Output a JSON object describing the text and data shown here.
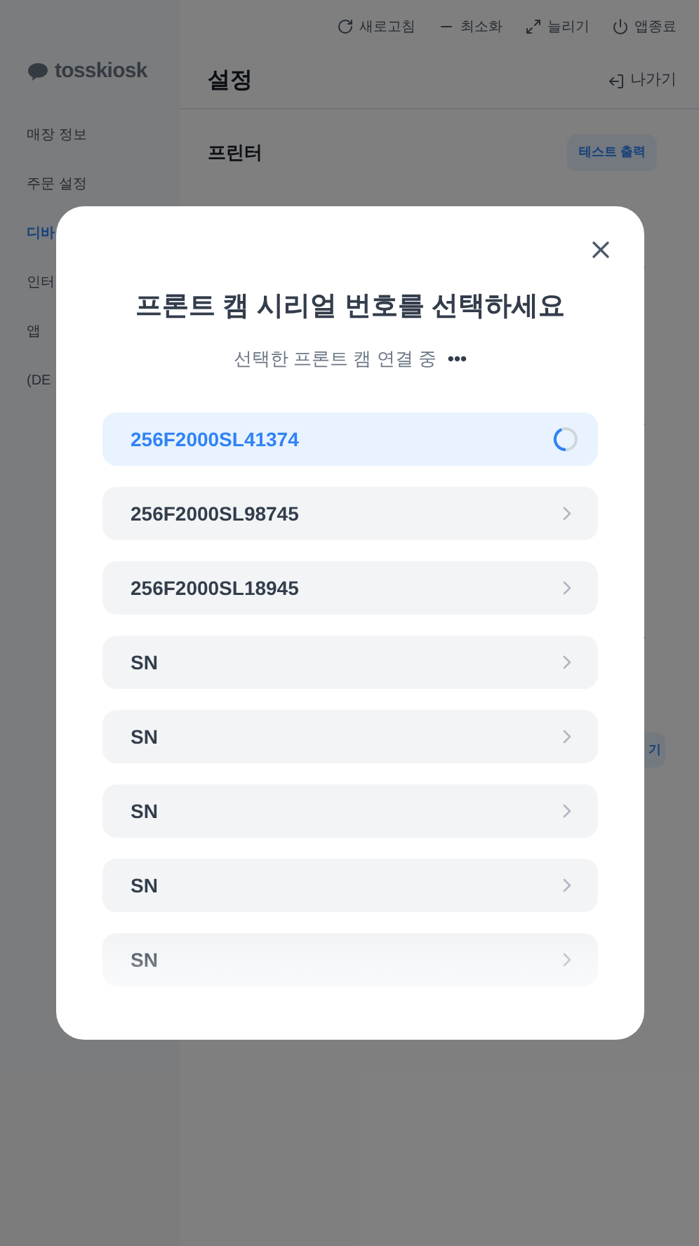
{
  "top_bar": {
    "actions": [
      {
        "kind": "refresh",
        "label": "새로고침"
      },
      {
        "kind": "minimize",
        "label": "최소화"
      },
      {
        "kind": "expand",
        "label": "늘리기"
      },
      {
        "kind": "power",
        "label": "앱종료"
      }
    ]
  },
  "sidebar": {
    "logo": "tosskiosk",
    "items": [
      {
        "label": "매장 정보",
        "selected": false
      },
      {
        "label": "주문 설정",
        "selected": false
      },
      {
        "label": "디바",
        "selected": true
      },
      {
        "label": "인터",
        "selected": false
      },
      {
        "label": "앱",
        "selected": false
      },
      {
        "label": "(DE",
        "selected": false
      }
    ]
  },
  "header": {
    "title": "설정",
    "exit_label": "나가기"
  },
  "section": {
    "title": "프린터",
    "button": "테스트 출력",
    "side_button": "기"
  },
  "dialog": {
    "title": "프론트 캠 시리얼 번호를 선택하세요",
    "subtitle": "선택한 프론트 캠 연결 중",
    "subtitle_mark": "•••",
    "items": [
      {
        "label": "256F2000SL41374",
        "selected": true,
        "connecting": true
      },
      {
        "label": "256F2000SL98745",
        "selected": false,
        "connecting": false
      },
      {
        "label": "256F2000SL18945",
        "selected": false,
        "connecting": false
      },
      {
        "label": "SN",
        "selected": false,
        "connecting": false
      },
      {
        "label": "SN",
        "selected": false,
        "connecting": false
      },
      {
        "label": "SN",
        "selected": false,
        "connecting": false
      },
      {
        "label": "SN",
        "selected": false,
        "connecting": false
      },
      {
        "label": "SN",
        "selected": false,
        "connecting": false
      }
    ]
  }
}
